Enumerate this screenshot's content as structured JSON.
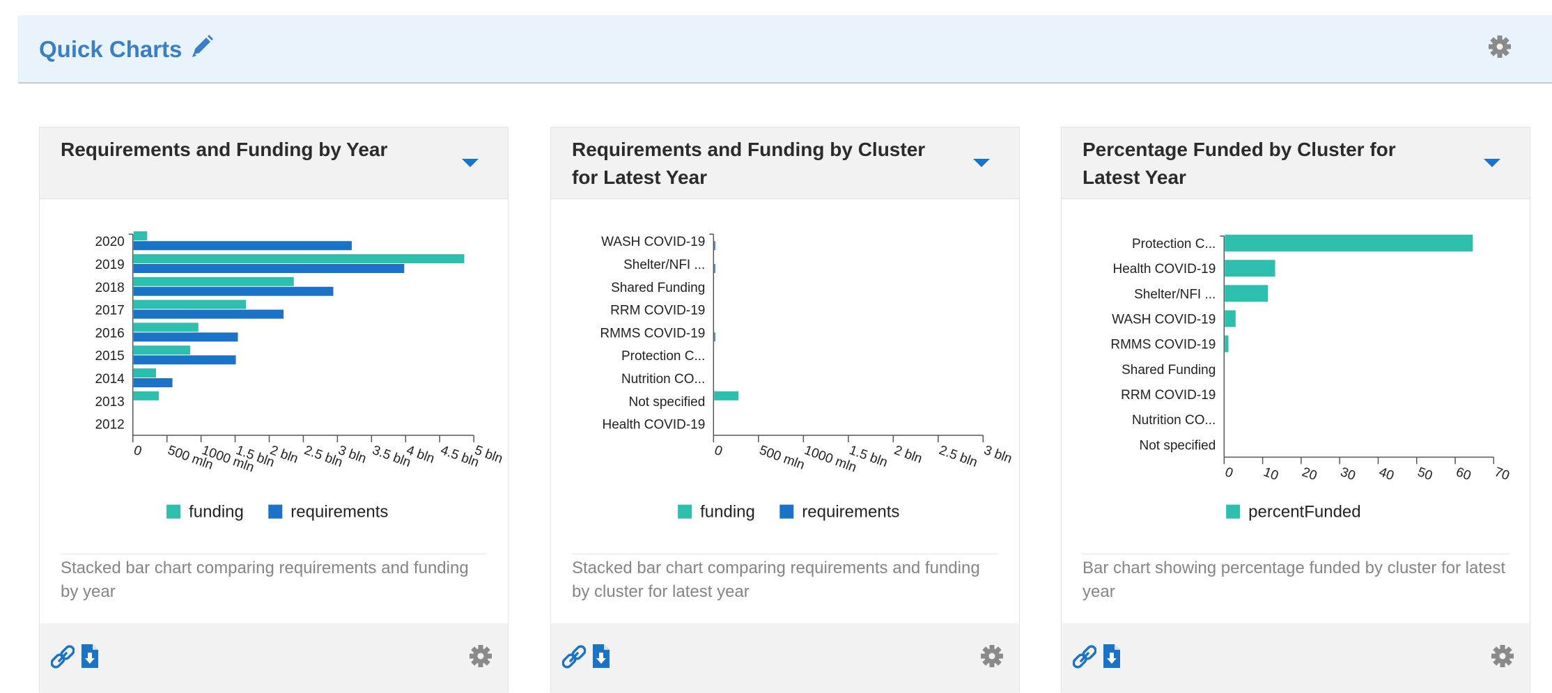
{
  "header": {
    "title": "Quick Charts",
    "pencil_icon": "pencil-icon",
    "gear_icon": "gear-icon"
  },
  "colors": {
    "funding": "#2dbfae",
    "requirements": "#1a73c6",
    "accent": "#1a73c6",
    "header_bg": "#e8f3fc",
    "title_blue": "#3a7fc4",
    "icon_gray": "#8a8a8a"
  },
  "cards": [
    {
      "title": "Requirements and Funding by Year",
      "caption": "Stacked bar chart comparing requirements and funding by year",
      "icons": [
        "link-icon",
        "download-icon",
        "gear-icon",
        "caret-down-icon"
      ]
    },
    {
      "title": "Requirements and Funding by Cluster for Latest Year",
      "caption": "Stacked bar chart comparing requirements and funding by cluster for latest year",
      "icons": [
        "link-icon",
        "download-icon",
        "gear-icon",
        "caret-down-icon"
      ]
    },
    {
      "title": "Percentage Funded by Cluster for Latest Year",
      "caption": "Bar chart showing percentage funded by cluster for latest year",
      "icons": [
        "link-icon",
        "download-icon",
        "gear-icon",
        "caret-down-icon"
      ]
    }
  ],
  "chart_data": [
    {
      "type": "bar",
      "orientation": "horizontal",
      "categories": [
        "2020",
        "2019",
        "2018",
        "2017",
        "2016",
        "2015",
        "2014",
        "2013",
        "2012"
      ],
      "series": [
        {
          "name": "funding",
          "values": [
            0.2,
            4.85,
            2.35,
            1.65,
            0.95,
            0.83,
            0.33,
            0.37,
            0.0
          ]
        },
        {
          "name": "requirements",
          "values": [
            3.2,
            3.97,
            2.93,
            2.2,
            1.53,
            1.5,
            0.57,
            0.0,
            0.0
          ]
        }
      ],
      "x_ticks": [
        "0",
        "500 mln",
        "1000 mln",
        "1.5 bln",
        "2 bln",
        "2.5 bln",
        "3 bln",
        "3.5 bln",
        "4 bln",
        "4.5 bln",
        "5 bln"
      ],
      "xlim": [
        0,
        5
      ],
      "x_unit": "bln",
      "legend": [
        "funding",
        "requirements"
      ],
      "legend_position": "bottom"
    },
    {
      "type": "bar",
      "orientation": "horizontal",
      "categories": [
        "WASH COVID-19",
        "Shelter/NFI ...",
        "Shared Funding",
        "RRM COVID-19",
        "RMMS COVID-19",
        "Protection C...",
        "Nutrition CO...",
        "Not specified",
        "Health COVID-19"
      ],
      "series": [
        {
          "name": "funding",
          "values": [
            0.0,
            0.0,
            0.0,
            0.0,
            0.0,
            0.0,
            0.0,
            0.27,
            0.0
          ]
        },
        {
          "name": "requirements",
          "values": [
            0.012,
            0.005,
            0.0,
            0.0,
            0.005,
            0.0,
            0.0,
            0.0,
            0.0
          ]
        }
      ],
      "x_ticks": [
        "0",
        "500 mln",
        "1000 mln",
        "1.5 bln",
        "2 bln",
        "2.5 bln",
        "3 bln"
      ],
      "xlim": [
        0,
        3
      ],
      "x_unit": "bln",
      "legend": [
        "funding",
        "requirements"
      ],
      "legend_position": "bottom"
    },
    {
      "type": "bar",
      "orientation": "horizontal",
      "categories": [
        "Protection C...",
        "Health COVID-19",
        "Shelter/NFI ...",
        "WASH COVID-19",
        "RMMS COVID-19",
        "Shared Funding",
        "RRM COVID-19",
        "Nutrition CO...",
        "Not specified"
      ],
      "series": [
        {
          "name": "percentFunded",
          "values": [
            69,
            14,
            12,
            3,
            1,
            0,
            0,
            0,
            0
          ]
        }
      ],
      "x_ticks": [
        "0",
        "10",
        "20",
        "30",
        "40",
        "50",
        "60",
        "70"
      ],
      "xlim": [
        0,
        75
      ],
      "legend": [
        "percentFunded"
      ],
      "legend_position": "bottom"
    }
  ]
}
